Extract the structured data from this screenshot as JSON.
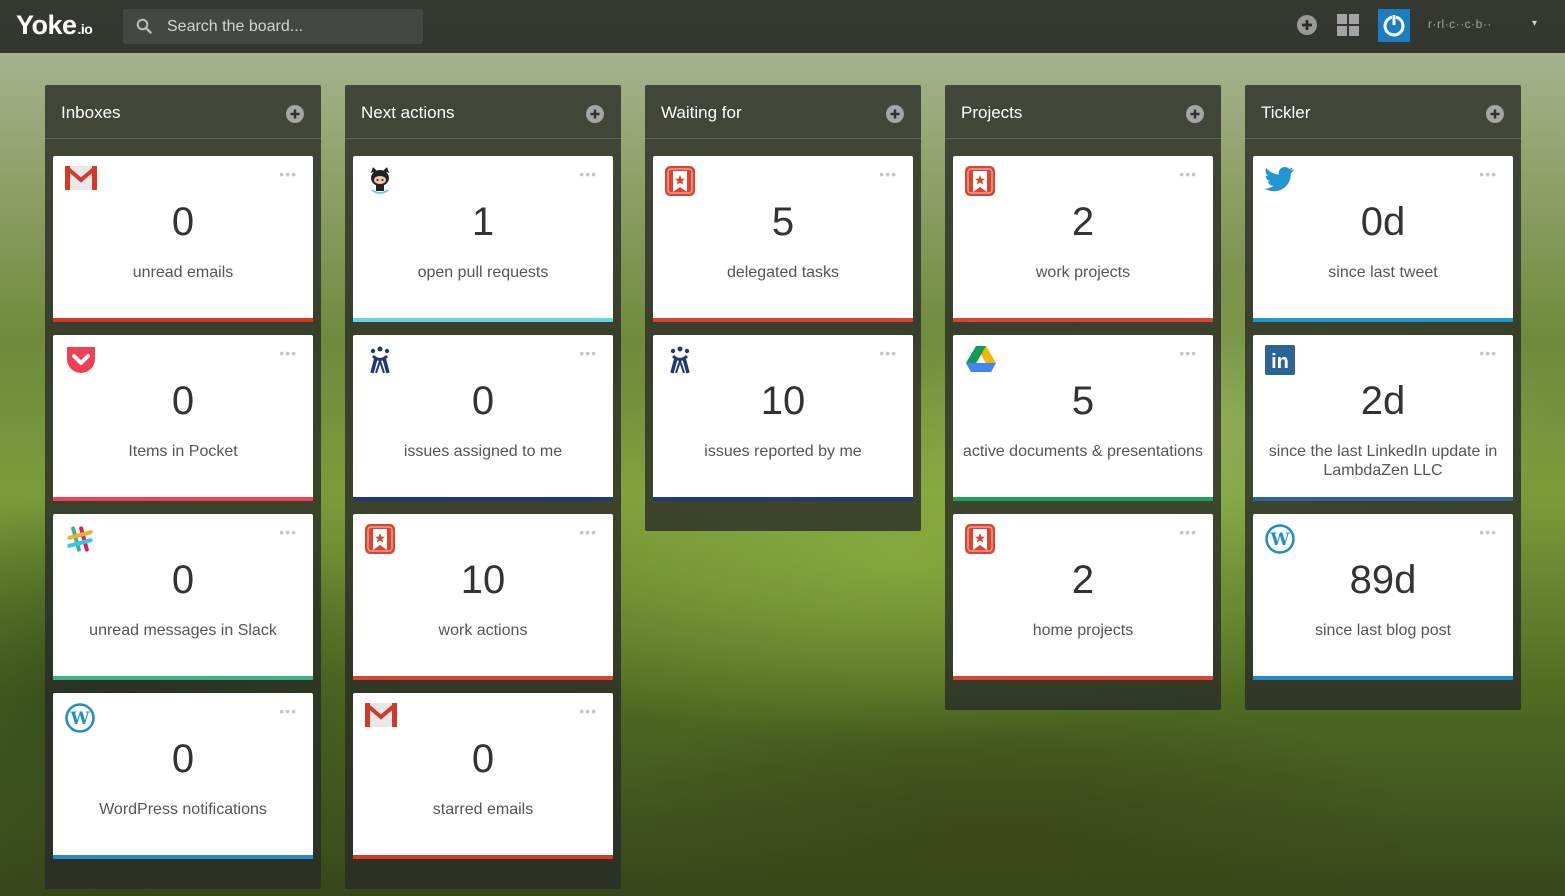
{
  "app": {
    "logo_main": "Yoke",
    "logo_suffix": ".io",
    "user_name": "r·rl·c··c·b··"
  },
  "search": {
    "placeholder": "Search the board..."
  },
  "colors": {
    "gmail": "#d13a29",
    "pocket": "#ef4056",
    "slack": "#3fb384",
    "wordpress": "#1f8ec6",
    "github": "#66d4e8",
    "jira": "#1f3a72",
    "wunderlist": "#d94532",
    "drive": "#1da15c",
    "twitter": "#2196d3",
    "linkedin": "#2d6496"
  },
  "columns": [
    {
      "title": "Inboxes",
      "cards": [
        {
          "icon": "gmail-icon",
          "value": "0",
          "label": "unread emails",
          "bar": "#d13a29"
        },
        {
          "icon": "pocket-icon",
          "value": "0",
          "label": "Items in Pocket",
          "bar": "#ef4056"
        },
        {
          "icon": "slack-icon",
          "value": "0",
          "label": "unread messages in Slack",
          "bar": "#3fb384"
        },
        {
          "icon": "wordpress-icon",
          "value": "0",
          "label": "WordPress notifications",
          "bar": "#1f8ec6"
        }
      ]
    },
    {
      "title": "Next actions",
      "cards": [
        {
          "icon": "github-octocat-icon",
          "value": "1",
          "label": "open pull requests",
          "bar": "#66d4e8"
        },
        {
          "icon": "jira-icon",
          "value": "0",
          "label": "issues assigned to me",
          "bar": "#1f3a72"
        },
        {
          "icon": "wunderlist-icon",
          "value": "10",
          "label": "work actions",
          "bar": "#d94532"
        },
        {
          "icon": "gmail-icon",
          "value": "0",
          "label": "starred emails",
          "bar": "#d13a29"
        }
      ]
    },
    {
      "title": "Waiting for",
      "cards": [
        {
          "icon": "wunderlist-icon",
          "value": "5",
          "label": "delegated tasks",
          "bar": "#d94532"
        },
        {
          "icon": "jira-icon",
          "value": "10",
          "label": "issues reported by me",
          "bar": "#1f3a72"
        }
      ]
    },
    {
      "title": "Projects",
      "cards": [
        {
          "icon": "wunderlist-icon",
          "value": "2",
          "label": "work projects",
          "bar": "#d94532"
        },
        {
          "icon": "google-drive-icon",
          "value": "5",
          "label": "active documents & presentations",
          "bar": "#1da15c"
        },
        {
          "icon": "wunderlist-icon",
          "value": "2",
          "label": "home projects",
          "bar": "#d94532"
        }
      ]
    },
    {
      "title": "Tickler",
      "cards": [
        {
          "icon": "twitter-icon",
          "value": "0d",
          "label": "since last tweet",
          "bar": "#2196d3"
        },
        {
          "icon": "linkedin-icon",
          "value": "2d",
          "label": "since the last LinkedIn update in LambdaZen LLC",
          "bar": "#2d6496"
        },
        {
          "icon": "wordpress-icon",
          "value": "89d",
          "label": "since last blog post",
          "bar": "#1f8ec6"
        }
      ]
    }
  ]
}
